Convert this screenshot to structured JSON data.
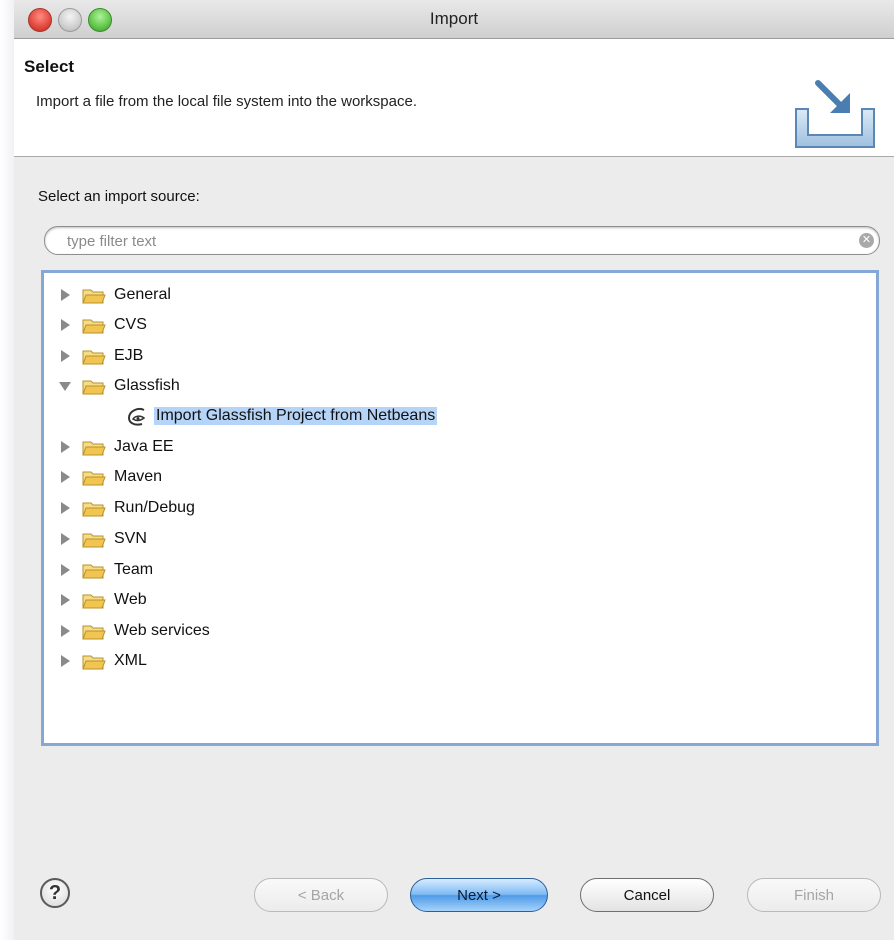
{
  "window": {
    "title": "Import"
  },
  "header": {
    "title": "Select",
    "description": "Import a file from the local file system into the workspace."
  },
  "source_label": "Select an import source:",
  "filter": {
    "placeholder": "type filter text",
    "value": ""
  },
  "tree": {
    "items": [
      {
        "label": "General",
        "expanded": false
      },
      {
        "label": "CVS",
        "expanded": false
      },
      {
        "label": "EJB",
        "expanded": false
      },
      {
        "label": "Glassfish",
        "expanded": true
      },
      {
        "label": "Import Glassfish Project from Netbeans",
        "selected": true
      },
      {
        "label": "Java EE",
        "expanded": false
      },
      {
        "label": "Maven",
        "expanded": false
      },
      {
        "label": "Run/Debug",
        "expanded": false
      },
      {
        "label": "SVN",
        "expanded": false
      },
      {
        "label": "Team",
        "expanded": false
      },
      {
        "label": "Web",
        "expanded": false
      },
      {
        "label": "Web services",
        "expanded": false
      },
      {
        "label": "XML",
        "expanded": false
      }
    ]
  },
  "buttons": {
    "help": "?",
    "back": "< Back",
    "next": "Next >",
    "cancel": "Cancel",
    "finish": "Finish"
  },
  "colors": {
    "selection": "#b5d4f7",
    "tree_border": "#86a8d6",
    "folder": "#f1c550",
    "primary_button": "#4f9be8"
  }
}
